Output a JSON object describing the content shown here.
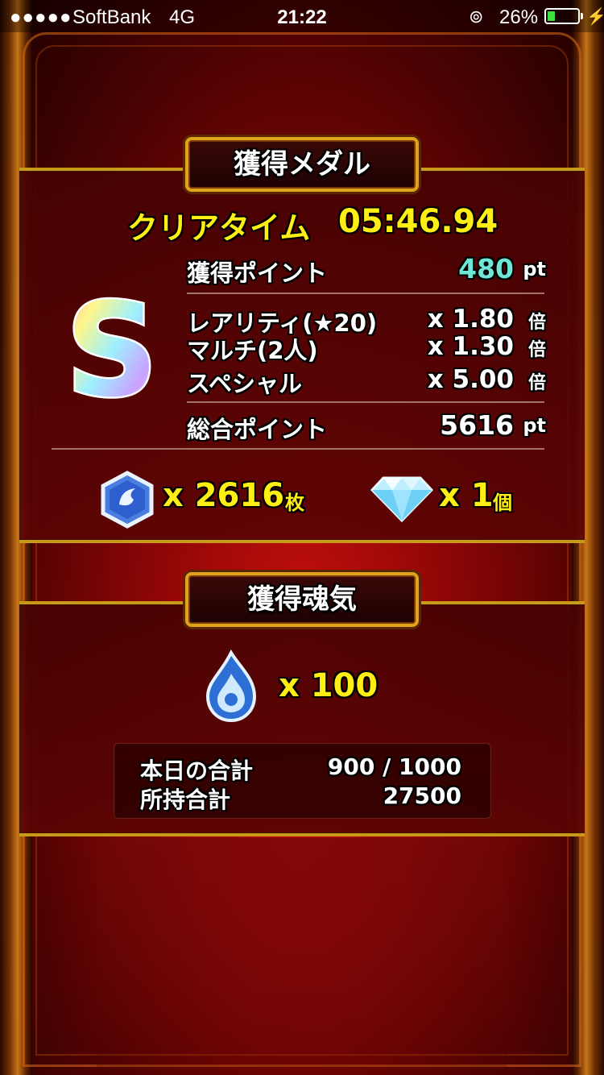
{
  "status_bar": {
    "signal": "●●●●●",
    "carrier": "SoftBank",
    "network": "4G",
    "time": "21:22",
    "battery_percent": "26%",
    "battery_level": 0.26,
    "battery_color": "#3ee23a"
  },
  "medal_panel": {
    "title": "獲得メダル",
    "clear_time_label": "クリアタイム",
    "clear_time": "05:46.94",
    "rank": "S",
    "earned_points_label": "獲得ポイント",
    "earned_points": "480",
    "pt_unit": "pt",
    "multipliers": [
      {
        "label": "レアリティ(★20)",
        "value": "x 1.80",
        "unit": "倍"
      },
      {
        "label": "マルチ(2人)",
        "value": "x 1.30",
        "unit": "倍"
      },
      {
        "label": "スペシャル",
        "value": "x 5.00",
        "unit": "倍"
      }
    ],
    "total_points_label": "総合ポイント",
    "total_points": "5616",
    "medal_reward": {
      "icon": "medal-icon",
      "amount": "x 2616",
      "unit": "枚"
    },
    "orb_reward": {
      "icon": "orb-gem-icon",
      "amount": "x 1",
      "unit": "個"
    }
  },
  "soul_panel": {
    "title": "獲得魂気",
    "soul_reward": {
      "icon": "soul-flame-icon",
      "amount": "x 100"
    },
    "today_total_label": "本日の合計",
    "today_total": "900 / 1000",
    "owned_total_label": "所持合計",
    "owned_total": "27500"
  },
  "colors": {
    "accent_yellow": "#ffee14",
    "points_cyan": "#6fe6d6",
    "gold_border": "#c99a1a"
  }
}
